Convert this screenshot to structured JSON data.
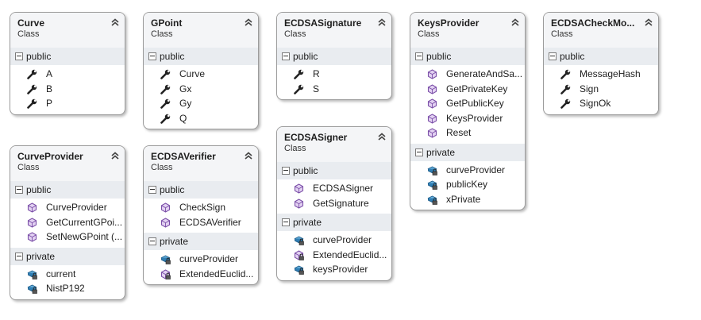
{
  "colors": {
    "border": "#9c9c9c",
    "header_bg": "#f4f5f7",
    "section_bg": "#e9ecf0",
    "method_icon": "#8a5ab4",
    "field_icon": "#2f7fb5"
  },
  "classes": [
    {
      "name": "Curve",
      "stereotype": "Class",
      "sections": [
        {
          "label": "public",
          "members": [
            {
              "name": "A",
              "icon": "wrench-icon"
            },
            {
              "name": "B",
              "icon": "wrench-icon"
            },
            {
              "name": "P",
              "icon": "wrench-icon"
            }
          ]
        }
      ]
    },
    {
      "name": "GPoint",
      "stereotype": "Class",
      "sections": [
        {
          "label": "public",
          "members": [
            {
              "name": "Curve",
              "icon": "wrench-icon"
            },
            {
              "name": "Gx",
              "icon": "wrench-icon"
            },
            {
              "name": "Gy",
              "icon": "wrench-icon"
            },
            {
              "name": "Q",
              "icon": "wrench-icon"
            }
          ]
        }
      ]
    },
    {
      "name": "ECDSASignature",
      "stereotype": "Class",
      "sections": [
        {
          "label": "public",
          "members": [
            {
              "name": "R",
              "icon": "wrench-icon"
            },
            {
              "name": "S",
              "icon": "wrench-icon"
            }
          ]
        }
      ]
    },
    {
      "name": "KeysProvider",
      "stereotype": "Class",
      "sections": [
        {
          "label": "public",
          "members": [
            {
              "name": "GenerateAndSa...",
              "icon": "method-icon"
            },
            {
              "name": "GetPrivateKey",
              "icon": "method-icon"
            },
            {
              "name": "GetPublicKey",
              "icon": "method-icon"
            },
            {
              "name": "KeysProvider",
              "icon": "method-icon"
            },
            {
              "name": "Reset",
              "icon": "method-icon"
            }
          ]
        },
        {
          "label": "private",
          "members": [
            {
              "name": "curveProvider",
              "icon": "private-field-icon"
            },
            {
              "name": "publicKey",
              "icon": "private-field-icon"
            },
            {
              "name": "xPrivate",
              "icon": "private-field-icon"
            }
          ]
        }
      ]
    },
    {
      "name": "ECDSACheckMo...",
      "stereotype": "Class",
      "sections": [
        {
          "label": "public",
          "members": [
            {
              "name": "MessageHash",
              "icon": "wrench-icon"
            },
            {
              "name": "Sign",
              "icon": "wrench-icon"
            },
            {
              "name": "SignOk",
              "icon": "wrench-icon"
            }
          ]
        }
      ]
    },
    {
      "name": "CurveProvider",
      "stereotype": "Class",
      "sections": [
        {
          "label": "public",
          "members": [
            {
              "name": "CurveProvider",
              "icon": "method-icon"
            },
            {
              "name": "GetCurrentGPoi...",
              "icon": "method-icon"
            },
            {
              "name": "SetNewGPoint  (...",
              "icon": "method-icon"
            }
          ]
        },
        {
          "label": "private",
          "members": [
            {
              "name": "current",
              "icon": "private-field-icon"
            },
            {
              "name": "NistP192",
              "icon": "private-field-icon"
            }
          ]
        }
      ]
    },
    {
      "name": "ECDSAVerifier",
      "stereotype": "Class",
      "sections": [
        {
          "label": "public",
          "members": [
            {
              "name": "CheckSign",
              "icon": "method-icon"
            },
            {
              "name": "ECDSAVerifier",
              "icon": "method-icon"
            }
          ]
        },
        {
          "label": "private",
          "members": [
            {
              "name": "curveProvider",
              "icon": "private-field-icon"
            },
            {
              "name": "ExtendedEuclid...",
              "icon": "private-method-icon"
            }
          ]
        }
      ]
    },
    {
      "name": "ECDSASigner",
      "stereotype": "Class",
      "sections": [
        {
          "label": "public",
          "members": [
            {
              "name": "ECDSASigner",
              "icon": "method-icon"
            },
            {
              "name": "GetSignature",
              "icon": "method-icon"
            }
          ]
        },
        {
          "label": "private",
          "members": [
            {
              "name": "curveProvider",
              "icon": "private-field-icon"
            },
            {
              "name": "ExtendedEuclid...",
              "icon": "private-method-icon"
            },
            {
              "name": "keysProvider",
              "icon": "private-field-icon"
            }
          ]
        }
      ]
    }
  ]
}
